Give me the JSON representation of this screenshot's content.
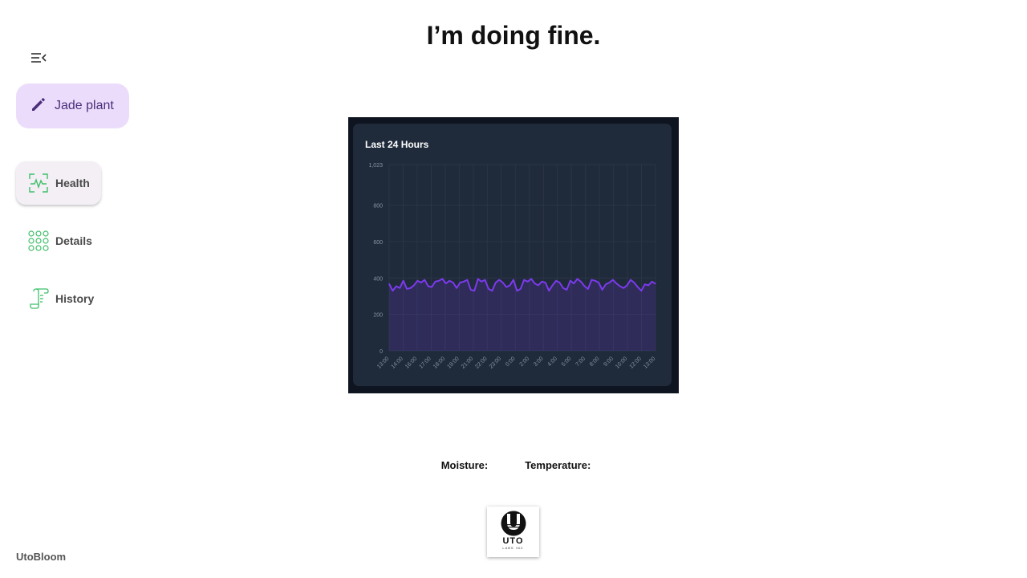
{
  "app": {
    "name": "UtoBloom"
  },
  "nav": {
    "plant_button": {
      "label": "Jade plant",
      "icon": "pencil-icon"
    },
    "items": [
      {
        "label": "Health",
        "icon": "heart-monitor-icon",
        "active": true
      },
      {
        "label": "Details",
        "icon": "dots-grid-icon",
        "active": false
      },
      {
        "label": "History",
        "icon": "scroll-icon",
        "active": false
      }
    ]
  },
  "main": {
    "status": "I’m doing fine.",
    "readings": {
      "moisture_label": "Moisture:",
      "temperature_label": "Temperature:"
    },
    "logo": {
      "word": "UTO",
      "subtitle": "LABS INC"
    }
  },
  "colors": {
    "accent": "#7c3aed",
    "nav_fab_bg": "#ecdcfb",
    "nav_icon": "#3fbf6a",
    "chart_bg": "#1f2a3a"
  },
  "chart_data": {
    "type": "area",
    "title": "Last 24 Hours",
    "xlabel": "",
    "ylabel": "",
    "ylim": [
      0,
      1023
    ],
    "yticks": [
      0,
      200,
      400,
      600,
      800,
      1023
    ],
    "ytick_labels": [
      "0",
      "200",
      "400",
      "600",
      "800",
      "1,023"
    ],
    "xtick_labels": [
      "13:00",
      "14:00",
      "16:00",
      "17:00",
      "18:00",
      "19:00",
      "21:00",
      "22:00",
      "23:00",
      "0:00",
      "2:00",
      "3:00",
      "4:00",
      "5:00",
      "7:00",
      "8:00",
      "9:00",
      "10:00",
      "12:00",
      "13:00"
    ],
    "series": [
      {
        "color": "#7c3aed",
        "values": [
          368,
          330,
          355,
          345,
          385,
          340,
          345,
          360,
          385,
          375,
          390,
          355,
          350,
          380,
          385,
          395,
          370,
          385,
          375,
          345,
          375,
          380,
          390,
          335,
          330,
          395,
          380,
          390,
          340,
          330,
          375,
          390,
          375,
          350,
          360,
          390,
          330,
          340,
          390,
          380,
          395,
          370,
          360,
          380,
          375,
          330,
          360,
          385,
          375,
          345,
          335,
          385,
          370,
          395,
          380,
          355,
          340,
          390,
          385,
          375,
          335,
          365,
          375,
          390,
          370,
          355,
          345,
          360,
          390,
          375,
          350,
          330,
          365,
          360,
          380,
          368
        ]
      }
    ]
  }
}
